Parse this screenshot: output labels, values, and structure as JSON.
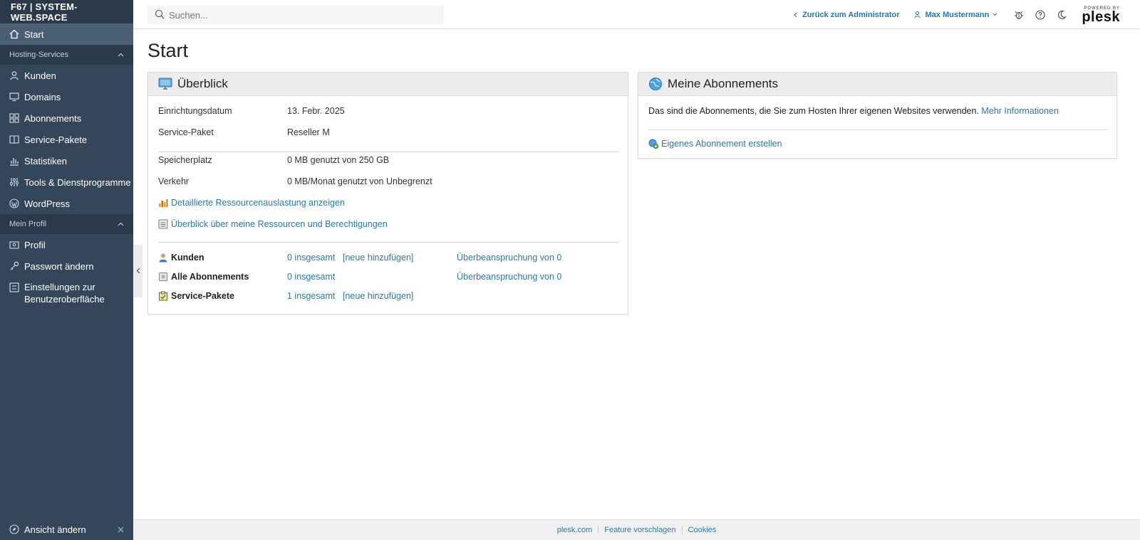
{
  "sidebar": {
    "brand": "F67 | SYSTEM-WEB.SPACE",
    "start": "Start",
    "hosting_section": "Hosting-Services",
    "hosting_items": [
      "Kunden",
      "Domains",
      "Abonnements",
      "Service-Pakete",
      "Statistiken",
      "Tools & Dienstprogramme",
      "WordPress"
    ],
    "profile_section": "Mein Profil",
    "profile_items": [
      "Profil",
      "Passwort ändern"
    ],
    "ui_settings_line1": "Einstellungen zur",
    "ui_settings_line2": "Benutzeroberfläche",
    "change_view": "Ansicht ändern"
  },
  "topbar": {
    "search_placeholder": "Suchen...",
    "back_link": "Zurück zum Administrator",
    "user_name": "Max Mustermann",
    "logo_powered": "POWERED BY",
    "logo_name": "plesk"
  },
  "page": {
    "title": "Start"
  },
  "overview": {
    "title": "Überblick",
    "setup_date_label": "Einrichtungsdatum",
    "setup_date_value": "13. Febr. 2025",
    "plan_label": "Service-Paket",
    "plan_value": "Reseller M",
    "disk_label": "Speicherplatz",
    "disk_value": "0 MB genutzt von 250 GB",
    "traffic_label": "Verkehr",
    "traffic_value": "0 MB/Monat genutzt von Unbegrenzt",
    "link_resource_usage": "Detaillierte Ressourcenauslastung anzeigen",
    "link_resources_permissions": "Überblick über meine Ressourcen und Berechtigungen",
    "stats": [
      {
        "label": "Kunden",
        "total": "0 insgesamt",
        "add": "[neue hinzufügen]",
        "overuse": "Überbeanspruchung von 0"
      },
      {
        "label": "Alle Abonnements",
        "total": "0 insgesamt",
        "add": "",
        "overuse": "Überbeanspruchung von 0"
      },
      {
        "label": "Service-Pakete",
        "total": "1 insgesamt",
        "add": "[neue hinzufügen]",
        "overuse": ""
      }
    ]
  },
  "subscriptions": {
    "title": "Meine Abonnements",
    "description": "Das sind die Abonnements, die Sie zum Hosten Ihrer eigenen Websites verwenden.",
    "more_info": "Mehr Informationen",
    "create_link": "Eigenes Abonnement erstellen"
  },
  "footer": {
    "links": [
      "plesk.com",
      "Feature vorschlagen",
      "Cookies"
    ]
  },
  "colors": {
    "sidebar_bg": "#34475a",
    "link": "#2a7aa9"
  }
}
